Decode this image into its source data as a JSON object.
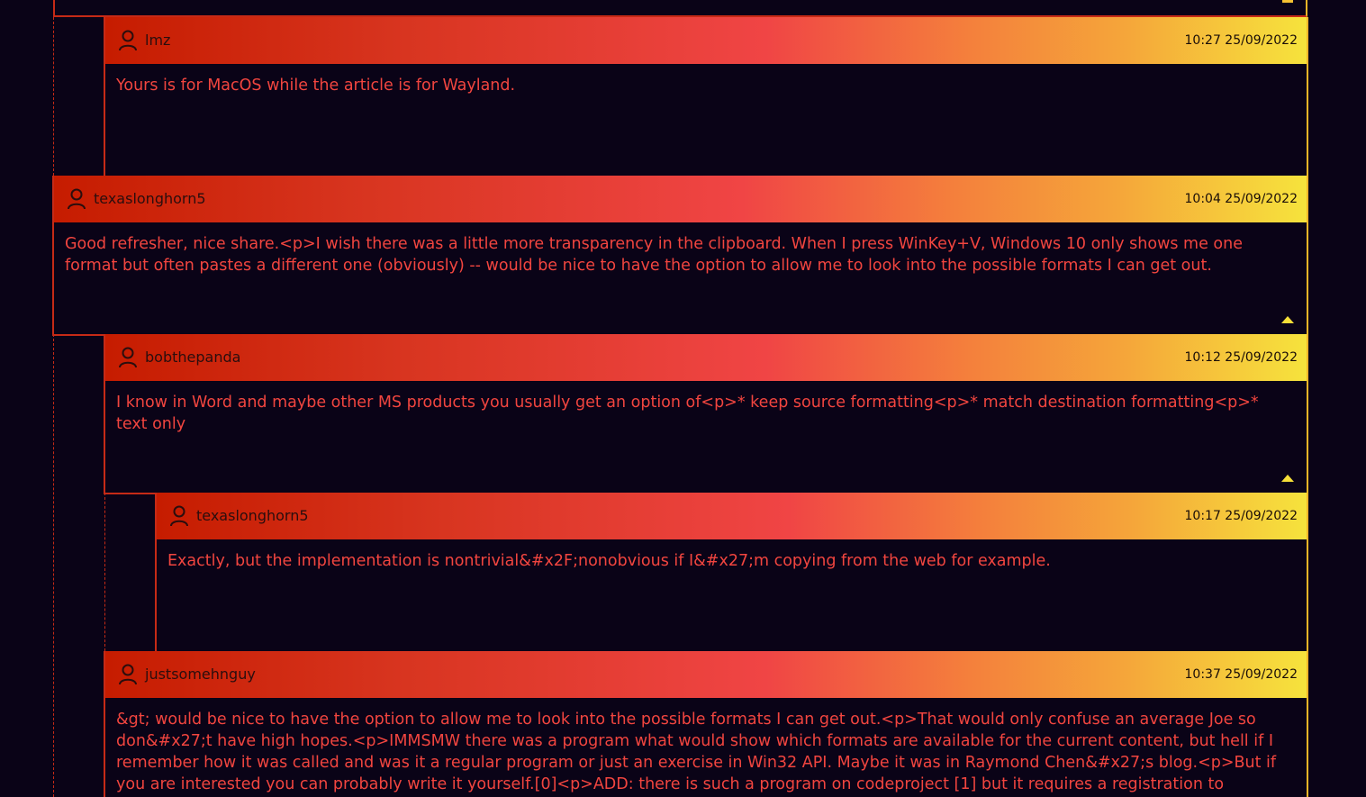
{
  "comments": [
    {
      "user": "lmz",
      "timestamp": "10:27 25/09/2022",
      "text": "Yours is for MacOS while the article is for Wayland."
    },
    {
      "user": "texaslonghorn5",
      "timestamp": "10:04 25/09/2022",
      "text": "Good refresher, nice share.<p>I wish there was a little more transparency in the clipboard. When I press WinKey+V, Windows 10 only shows me one format but often pastes a different one (obviously) -- would be nice to have the option to allow me to look into the possible formats I can get out."
    },
    {
      "user": "bobthepanda",
      "timestamp": "10:12 25/09/2022",
      "text": "I know in Word and maybe other MS products you usually get an option of<p>* keep source formatting<p>* match destination formatting<p>* text only"
    },
    {
      "user": "texaslonghorn5",
      "timestamp": "10:17 25/09/2022",
      "text": "Exactly, but the implementation is nontrivial&#x2F;nonobvious if I&#x27;m copying from the web for example."
    },
    {
      "user": "justsomehnguy",
      "timestamp": "10:37 25/09/2022",
      "text": "&gt; would be nice to have the option to allow me to look into the possible formats I can get out.<p>That would only confuse an average Joe so don&#x27;t have high hopes.<p>IMMSMW there was a program what would show which formats are available for the current content, but hell if I remember how it was called and was it a regular program or just an exercise in Win32 API. Maybe it was in Raymond Chen&#x27;s blog.<p>But if you are interested you can probably write it yourself.[0]<p>ADD: there is such a program on codeproject [1] but it requires a registration to"
    }
  ]
}
